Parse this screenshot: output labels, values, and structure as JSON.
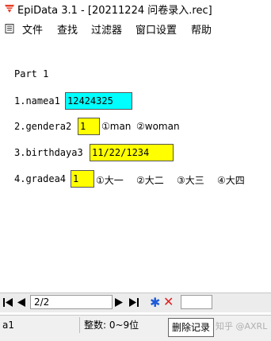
{
  "window": {
    "title": "EpiData 3.1 - [20211224 问卷录入.rec]"
  },
  "menu": {
    "items": [
      "文件",
      "查找",
      "过滤器",
      "窗口设置",
      "帮助"
    ]
  },
  "form": {
    "part": "Part 1",
    "q1": {
      "label": "1.namea1",
      "value": "12424325"
    },
    "q2": {
      "label": "2.gendera2",
      "value": "1",
      "options": [
        "①man",
        "②woman"
      ]
    },
    "q3": {
      "label": "3.birthdaya3",
      "value": "11/22/1234"
    },
    "q4": {
      "label": "4.gradea4",
      "value": "1",
      "options": [
        "①大一",
        "②大二",
        "③大三",
        "④大四"
      ]
    }
  },
  "navigator": {
    "record": "2/2",
    "first_icon": "first-record-icon",
    "prev_icon": "prev-record-icon",
    "next_icon": "next-record-icon",
    "last_icon": "last-record-icon",
    "new_icon": "new-record-icon",
    "delete_icon": "delete-record-icon"
  },
  "status": {
    "field": "a1",
    "type": "整数: 0~9位"
  },
  "tooltip": "删除记录",
  "watermark": "知乎 @AXRL",
  "colors": {
    "field_text": "#00ffff",
    "field_numeric": "#ffff00"
  }
}
